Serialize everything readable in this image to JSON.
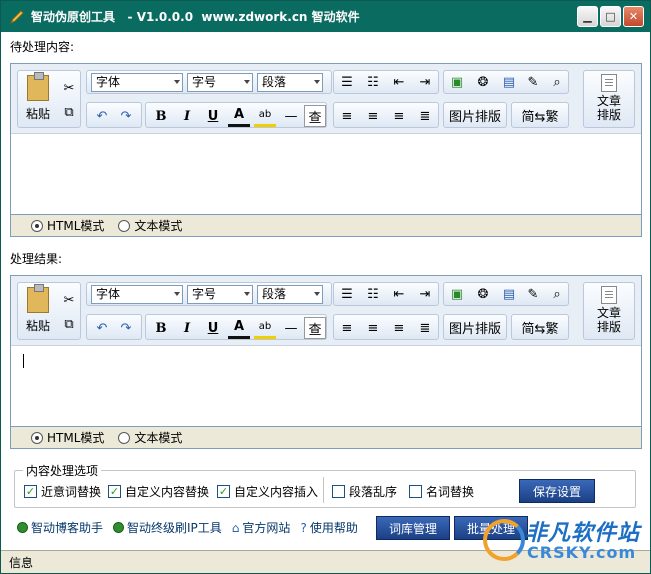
{
  "window": {
    "title": "智动伪原创工具   - V1.0.0.0  www.zdwork.cn 智动软件",
    "min": "▁",
    "max": "□",
    "close": "✕"
  },
  "input_section": {
    "label": "待处理内容:"
  },
  "result_section": {
    "label": "处理结果:"
  },
  "toolbar": {
    "paste": "粘贴",
    "font": "字体",
    "size": "字号",
    "paragraph": "段落",
    "bold": "B",
    "italic": "I",
    "underline": "U",
    "font_color": "A",
    "highlight": "ab",
    "hr": "—",
    "find": "查",
    "image_layout": "图片排版",
    "convert": "简⇆繁",
    "article_layout_1": "文章",
    "article_layout_2": "排版"
  },
  "modes": {
    "html": "HTML模式",
    "text": "文本模式"
  },
  "options": {
    "legend": "内容处理选项",
    "synonym": "近意词替换",
    "custom_replace": "自定义内容替换",
    "custom_insert": "自定义内容插入",
    "shuffle": "段落乱序",
    "noun_replace": "名词替换",
    "save": "保存设置"
  },
  "links": {
    "blog_helper": "智动博客助手",
    "ip_tool": "智动终级刷IP工具",
    "website": "官方网站",
    "help": "使用帮助"
  },
  "buttons": {
    "dict": "词库管理",
    "batch": "批量处理"
  },
  "status": {
    "text": "信息"
  },
  "watermark": {
    "line1": "非凡软件站",
    "line2": "CRSKY.com"
  },
  "colors": {
    "titlebar": "#0a6b60",
    "button_blue": "#2a56a8",
    "check_green": "#21a121"
  }
}
